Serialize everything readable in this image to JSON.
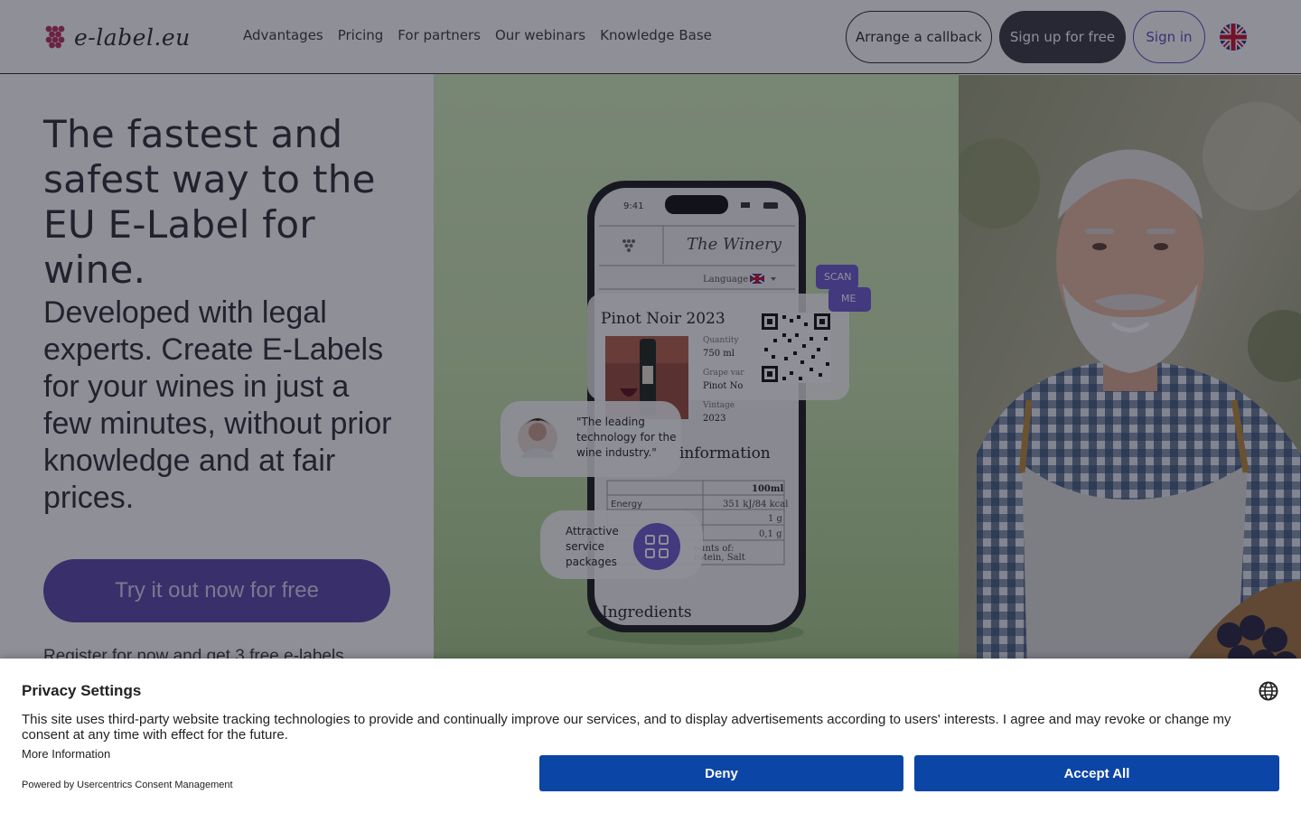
{
  "header": {
    "logo_text": "e-label.eu",
    "nav": [
      "Advantages",
      "Pricing",
      "For partners",
      "Our webinars",
      "Knowledge Base"
    ],
    "callback_label": "Arrange a callback",
    "signup_label": "Sign up for free",
    "signin_label": "Sign in",
    "language_icon": "uk-flag-icon"
  },
  "hero": {
    "title": "The fastest and safest way to the EU E-Label for wine.",
    "subtitle": "Developed with legal experts. Create E-Labels for your wines in just a few minutes, without prior knowledge and at fair prices.",
    "cta_label": "Try it out now for free",
    "note": "Register for now and get 3 free e-labels"
  },
  "phone": {
    "time": "9:41",
    "brand": "The Winery",
    "language_label": "Language",
    "wine_name": "Pinot Noir 2023",
    "quantity_label": "Quantity",
    "quantity_value": "750 ml",
    "grape_label": "Grape var",
    "grape_value": "Pinot No",
    "vintage_label": "Vintage",
    "vintage_value": "2023",
    "info_heading": "information",
    "table_header": "100ml",
    "energy_label": "Energy",
    "energy_value": "351 kJ/84 kcal",
    "row2_value": "1 g",
    "row3_value": "0,1 g",
    "amounts_text": "ounts of:",
    "protein_text": "rotein, Salt",
    "ingredients_heading": "Ingredients",
    "scan_tag": "SCAN",
    "me_tag": "ME",
    "quote": "\"The leading technology for the wine industry.\"",
    "packages_text": "Attractive service packages"
  },
  "consent": {
    "title": "Privacy Settings",
    "text": "This site uses third-party website tracking technologies to provide and continually improve our services, and to display advertisements according to users' interests. I agree and may revoke or change my consent at any time with effect for the future.",
    "more_info": "More Information",
    "powered_by": "Powered by Usercentrics Consent Management",
    "deny_label": "Deny",
    "accept_label": "Accept All"
  },
  "colors": {
    "brand_purple": "#5a48a8",
    "consent_blue": "#0b45a6",
    "dark_button": "#3a3940"
  }
}
